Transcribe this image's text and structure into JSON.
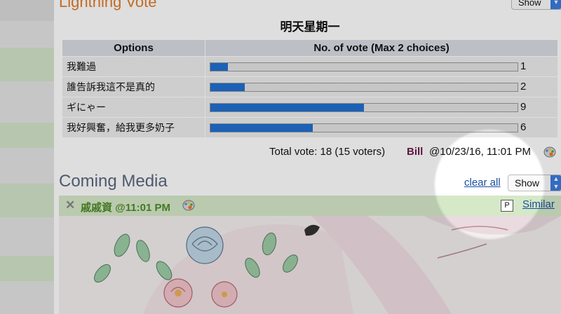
{
  "lightning_vote": {
    "title": "Lightning Vote",
    "show_label": "Show",
    "question": "明天星期一",
    "headers": {
      "options": "Options",
      "votes": "No. of vote (Max 2 choices)"
    },
    "rows": [
      {
        "option": "我難過",
        "count": "1",
        "fraction": 0.056
      },
      {
        "option": "誰告訴我這不是真的",
        "count": "2",
        "fraction": 0.112
      },
      {
        "option": "ギにゃー",
        "count": "9",
        "fraction": 0.5
      },
      {
        "option": "我好興奮，給我更多奶子",
        "count": "6",
        "fraction": 0.333
      }
    ],
    "total": "Total vote: 18 (15 voters)",
    "author": "Bill",
    "timestamp": "@10/23/16, 11:01 PM"
  },
  "coming_media": {
    "title": "Coming Media",
    "clear_all": "clear all",
    "show_label": "Show",
    "item": {
      "user_time": "戚戚資 @11:01 PM",
      "badge": "P",
      "similar": "Similar"
    }
  },
  "colors": {
    "bar_fill": "#1f6fd1",
    "section_orange": "#e07b2a",
    "link_blue": "#1a4fa0",
    "media_row_green": "#d5e8c8"
  }
}
